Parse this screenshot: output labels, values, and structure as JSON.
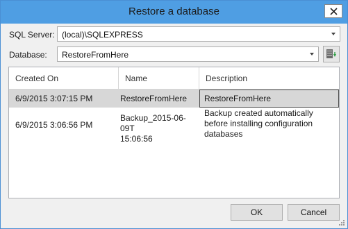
{
  "window": {
    "title": "Restore a database"
  },
  "server": {
    "label": "SQL Server:",
    "value": "(local)\\SQLEXPRESS"
  },
  "database": {
    "label": "Database:",
    "value": "RestoreFromHere"
  },
  "grid": {
    "columns": [
      "Created On",
      "Name",
      "Description"
    ],
    "rows": [
      {
        "created_on": "6/9/2015 3:07:15 PM",
        "name": "RestoreFromHere",
        "description": "RestoreFromHere",
        "selected": true
      },
      {
        "created_on": "6/9/2015 3:06:56 PM",
        "name_line1": "Backup_2015-06-09T",
        "name_line2": "15:06:56",
        "description_line1": "Backup created automatically",
        "description_line2": "before installing configuration",
        "description_line3": "databases",
        "selected": false
      }
    ]
  },
  "buttons": {
    "ok": "OK",
    "cancel": "Cancel"
  },
  "colors": {
    "titlebar": "#4f9ee3",
    "selected_row": "#d7d7d7",
    "dialog_bg": "#f0f0f0"
  },
  "icons": {
    "close": "close-icon",
    "dropdown": "chevron-down-icon",
    "database_action": "database-filter-icon",
    "resize_grip": "resize-grip-icon"
  }
}
